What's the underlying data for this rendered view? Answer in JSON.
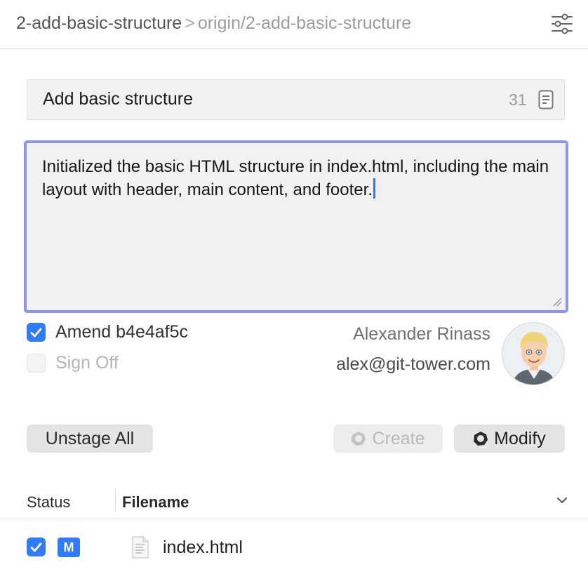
{
  "header": {
    "branch": "2-add-basic-structure",
    "separator": ">",
    "remote_branch": "origin/2-add-basic-structure"
  },
  "commit": {
    "subject": "Add basic structure",
    "char_count": "31",
    "body": "Initialized the basic HTML structure in index.html, including the main layout with header, main content, and footer."
  },
  "options": {
    "amend_label": "Amend b4e4af5c",
    "amend_checked": true,
    "signoff_label": "Sign Off",
    "signoff_checked": false
  },
  "author": {
    "name": "Alexander Rinass",
    "email": "alex@git-tower.com"
  },
  "buttons": {
    "unstage_all": "Unstage All",
    "create": "Create",
    "modify": "Modify"
  },
  "columns": {
    "status": "Status",
    "filename": "Filename"
  },
  "files": [
    {
      "checked": true,
      "status": "M",
      "name": "index.html"
    }
  ],
  "colors": {
    "accent": "#2f7cf6",
    "focus_ring": "#8c95e6"
  },
  "icons": {
    "settings": "sliders-icon",
    "subject_templates": "document-icon",
    "column_menu": "chevron-down-icon",
    "file": "file-icon"
  }
}
